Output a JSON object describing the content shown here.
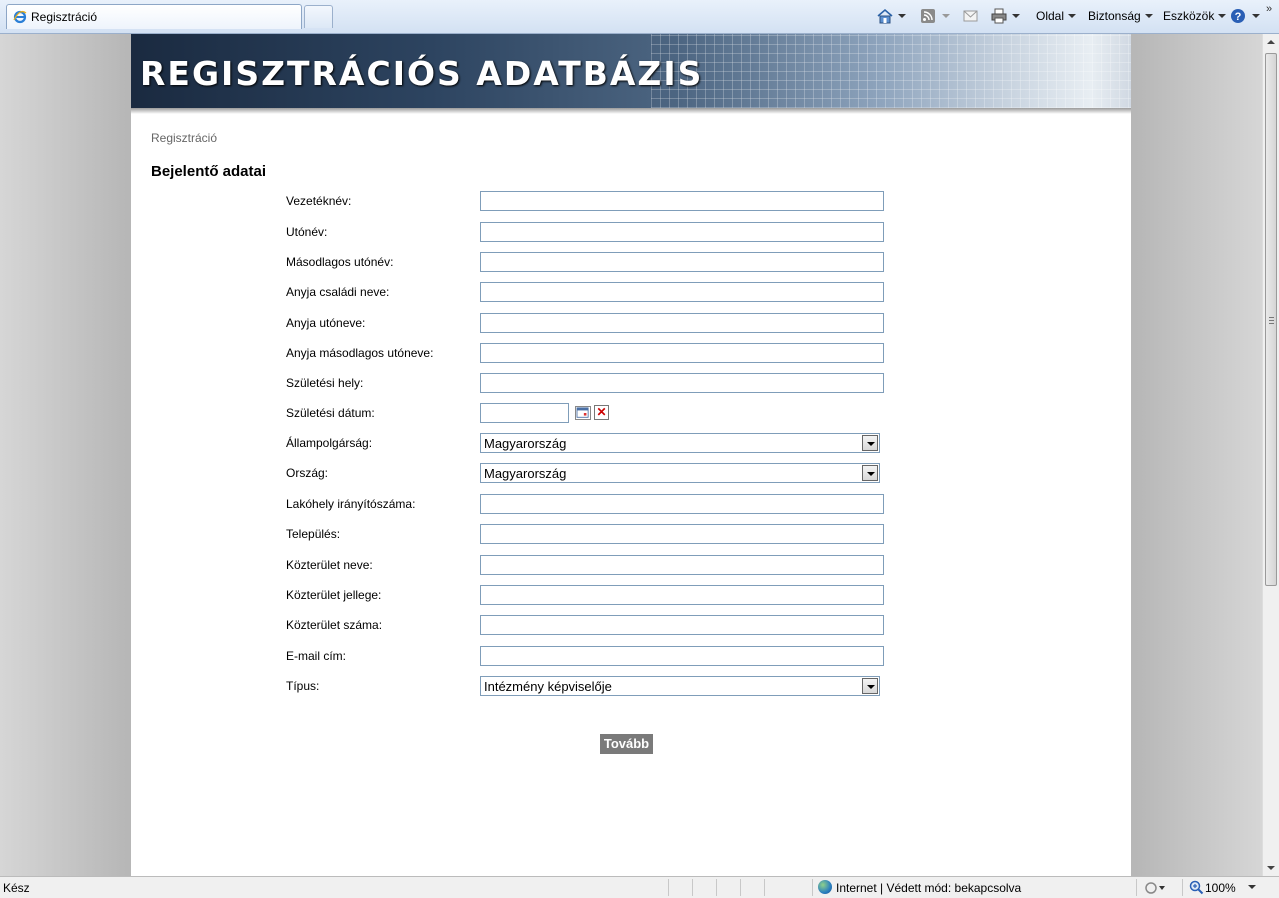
{
  "browser": {
    "tab_title": "Regisztráció",
    "commands": [
      {
        "label": "Oldal"
      },
      {
        "label": "Biztonság"
      },
      {
        "label": "Eszközök"
      }
    ],
    "chevron": "»"
  },
  "banner": {
    "title": "REGISZTRÁCIÓS ADATBÁZIS"
  },
  "breadcrumb": "Regisztráció",
  "section_title": "Bejelentő adatai",
  "form": {
    "fields": [
      {
        "label": "Vezetéknév:",
        "value": ""
      },
      {
        "label": "Utónév:",
        "value": ""
      },
      {
        "label": "Másodlagos utónév:",
        "value": ""
      },
      {
        "label": "Anyja családi neve:",
        "value": ""
      },
      {
        "label": "Anyja utóneve:",
        "value": ""
      },
      {
        "label": "Anyja másodlagos utóneve:",
        "value": ""
      },
      {
        "label": "Születési hely:",
        "value": ""
      },
      {
        "label": "Születési dátum:",
        "value": ""
      },
      {
        "label": "Állampolgárság:",
        "value": "Magyarország"
      },
      {
        "label": "Ország:",
        "value": "Magyarország"
      },
      {
        "label": "Lakóhely irányítószáma:",
        "value": ""
      },
      {
        "label": "Település:",
        "value": ""
      },
      {
        "label": "Közterület neve:",
        "value": ""
      },
      {
        "label": "Közterület jellege:",
        "value": ""
      },
      {
        "label": "Közterület száma:",
        "value": ""
      },
      {
        "label": "E-mail cím:",
        "value": ""
      },
      {
        "label": "Típus:",
        "value": "Intézmény képviselője"
      }
    ],
    "submit_label": "Tovább"
  },
  "statusbar": {
    "status": "Kész",
    "zone": "Internet | Védett mód: bekapcsolva",
    "zoom": "100%"
  }
}
